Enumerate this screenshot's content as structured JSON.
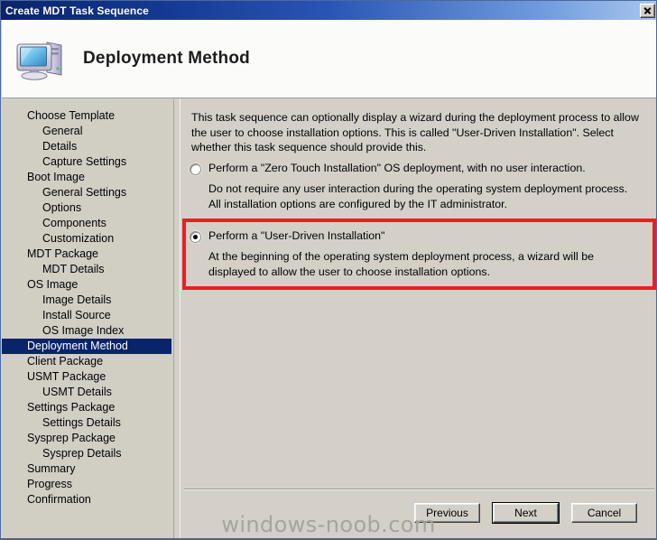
{
  "window": {
    "title": "Create MDT Task Sequence",
    "close_icon": "close-icon",
    "accent_title_start": "#0a246a",
    "accent_title_end": "#a9c6ee"
  },
  "header": {
    "icon": "computer-icon",
    "title": "Deployment Method"
  },
  "sidebar": {
    "items": [
      {
        "label": "Choose Template",
        "level": 0,
        "active": false
      },
      {
        "label": "General",
        "level": 1,
        "active": false
      },
      {
        "label": "Details",
        "level": 1,
        "active": false
      },
      {
        "label": "Capture Settings",
        "level": 1,
        "active": false
      },
      {
        "label": "Boot Image",
        "level": 0,
        "active": false
      },
      {
        "label": "General Settings",
        "level": 1,
        "active": false
      },
      {
        "label": "Options",
        "level": 1,
        "active": false
      },
      {
        "label": "Components",
        "level": 1,
        "active": false
      },
      {
        "label": "Customization",
        "level": 1,
        "active": false
      },
      {
        "label": "MDT Package",
        "level": 0,
        "active": false
      },
      {
        "label": "MDT Details",
        "level": 1,
        "active": false
      },
      {
        "label": "OS Image",
        "level": 0,
        "active": false
      },
      {
        "label": "Image Details",
        "level": 1,
        "active": false
      },
      {
        "label": "Install Source",
        "level": 1,
        "active": false
      },
      {
        "label": "OS Image Index",
        "level": 1,
        "active": false
      },
      {
        "label": "Deployment Method",
        "level": 0,
        "active": true
      },
      {
        "label": "Client Package",
        "level": 0,
        "active": false
      },
      {
        "label": "USMT Package",
        "level": 0,
        "active": false
      },
      {
        "label": "USMT Details",
        "level": 1,
        "active": false
      },
      {
        "label": "Settings Package",
        "level": 0,
        "active": false
      },
      {
        "label": "Settings Details",
        "level": 1,
        "active": false
      },
      {
        "label": "Sysprep Package",
        "level": 0,
        "active": false
      },
      {
        "label": "Sysprep Details",
        "level": 1,
        "active": false
      },
      {
        "label": "Summary",
        "level": 0,
        "active": false
      },
      {
        "label": "Progress",
        "level": 0,
        "active": false
      },
      {
        "label": "Confirmation",
        "level": 0,
        "active": false
      }
    ],
    "highlight_color": "#0a246a"
  },
  "main": {
    "intro": "This task sequence can optionally display a wizard during the deployment process to allow the user to choose installation options.  This is called \"User-Driven Installation\".  Select whether this task sequence should provide this.",
    "options": [
      {
        "label": "Perform a \"Zero Touch Installation\" OS deployment, with no user interaction.",
        "description": "Do not require any user interaction during the operating system deployment process.  All installation options are configured by the IT administrator.",
        "selected": false
      },
      {
        "label": "Perform a \"User-Driven Installation\"",
        "description": "At the beginning of the operating system deployment process, a wizard will be displayed to allow the user to choose installation options.",
        "selected": true
      }
    ]
  },
  "annotation": {
    "color": "#ee1c25",
    "target": "user-driven-installation-option"
  },
  "footer": {
    "previous_label": "Previous",
    "next_label": "Next",
    "cancel_label": "Cancel"
  },
  "watermark": {
    "text": "windows-noob.com"
  }
}
